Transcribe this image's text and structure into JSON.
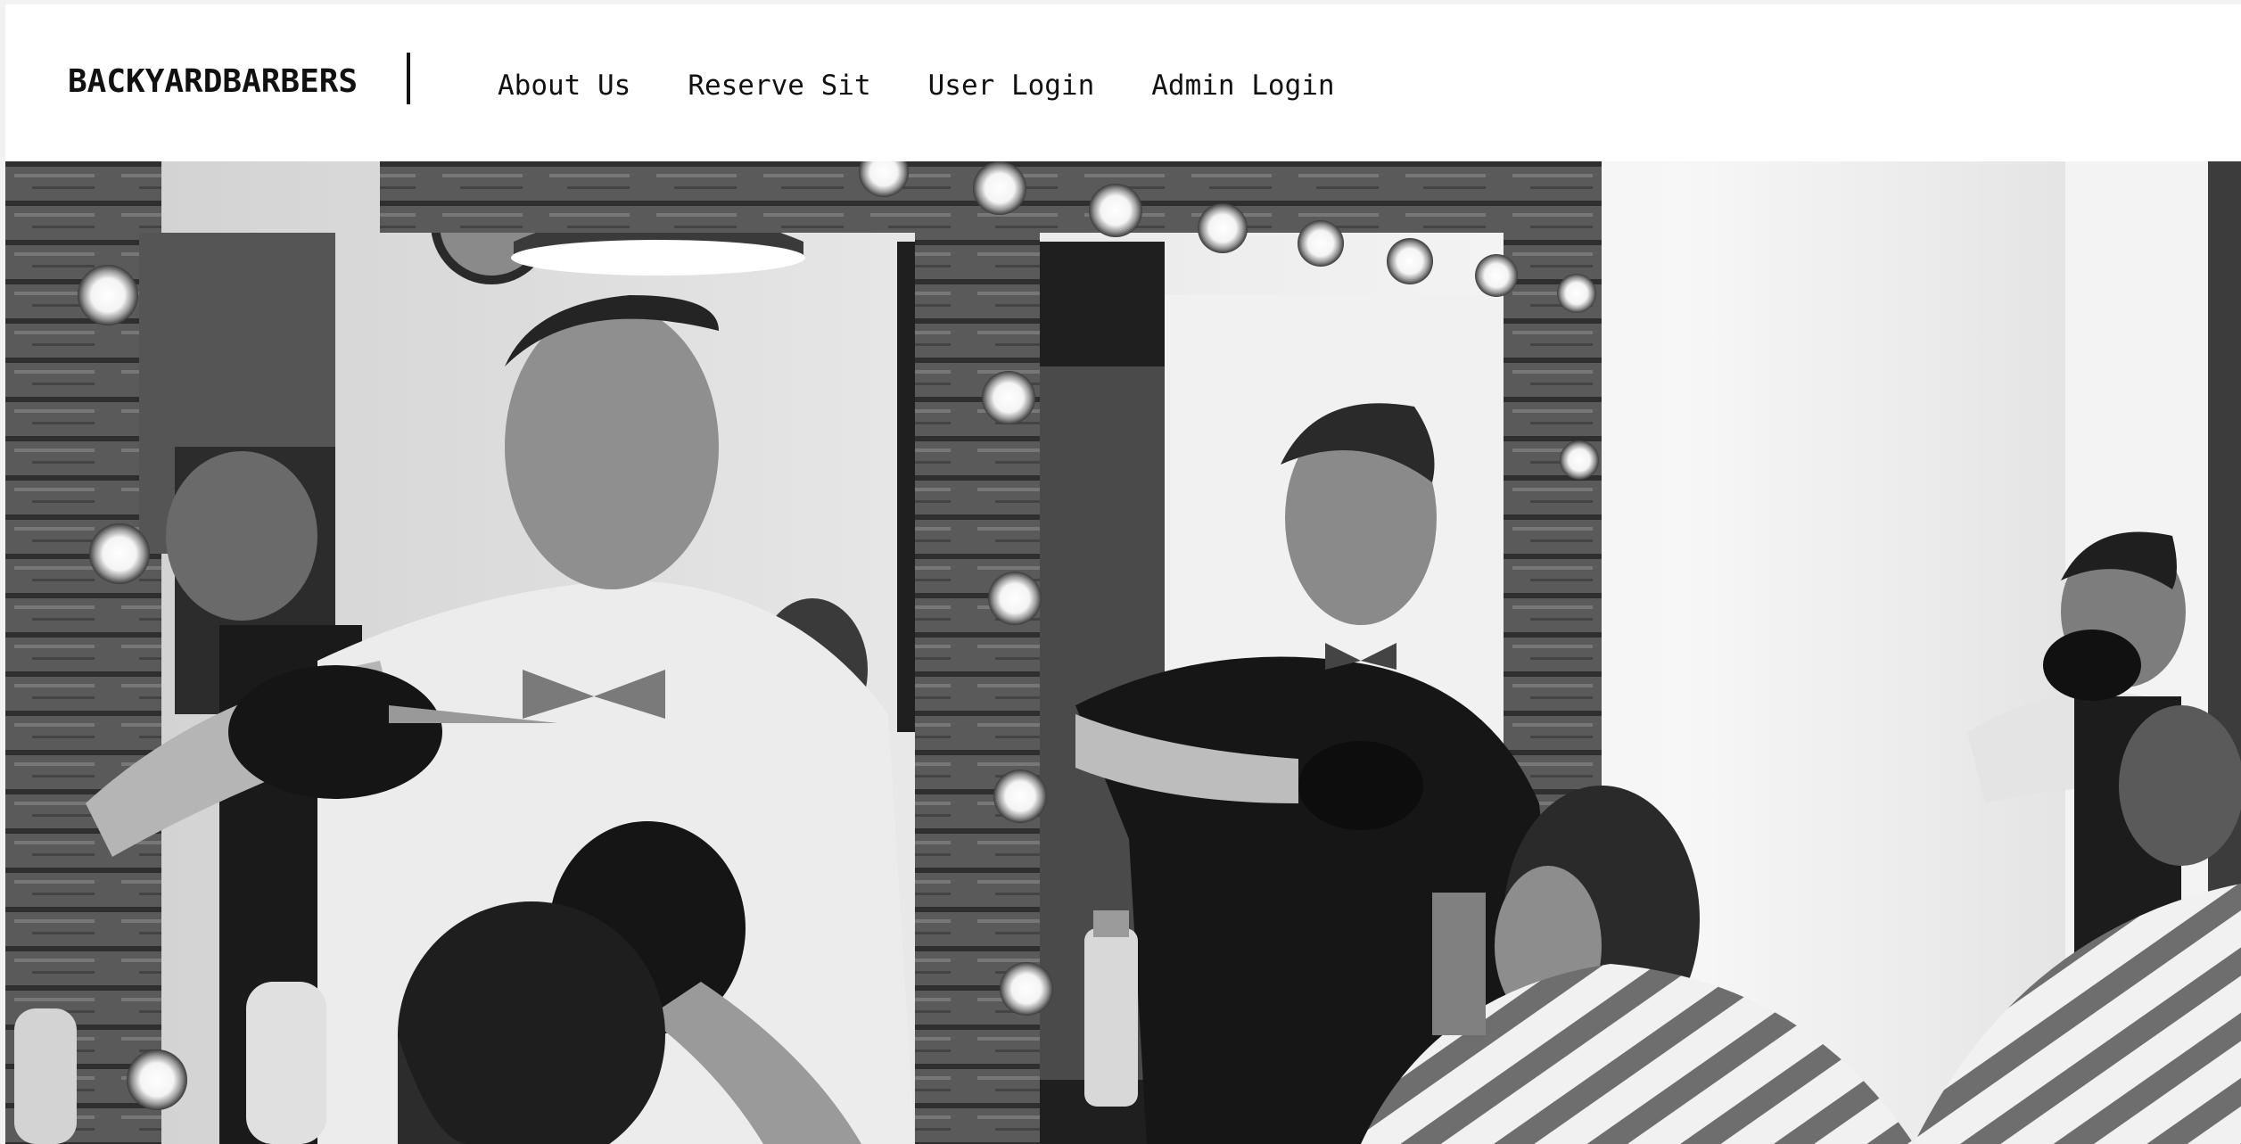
{
  "navbar": {
    "brand": "BACKYARDBARBERS",
    "links": [
      {
        "label": "About Us"
      },
      {
        "label": "Reserve Sit"
      },
      {
        "label": "User Login"
      },
      {
        "label": "Admin Login"
      }
    ]
  },
  "hero": {
    "image": "barbershop-photo",
    "tone": "grayscale"
  },
  "colors": {
    "background": "#ffffff",
    "text": "#111111",
    "divider": "#111111"
  }
}
